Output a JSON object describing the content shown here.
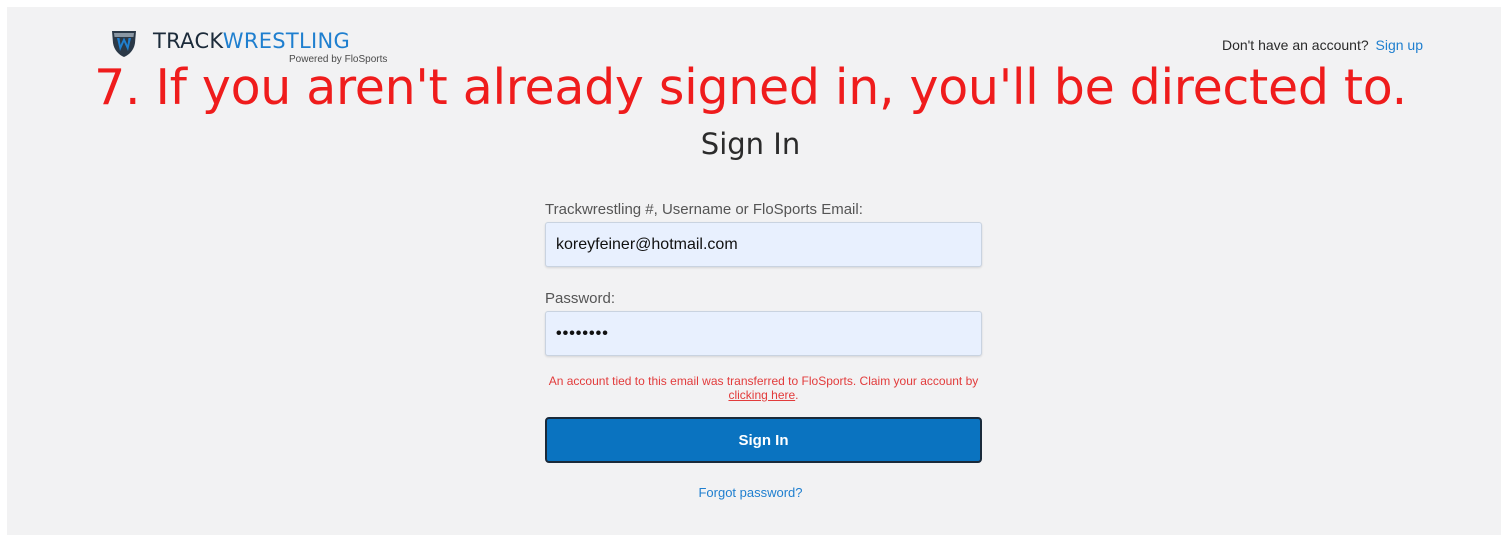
{
  "header": {
    "logo_icon": "trackwrestling-shield-logo",
    "brand_part1": "TRACK",
    "brand_part2": "WRESTLING",
    "powered_by": "Powered by FloSports",
    "signup_prompt": "Don't have an account?",
    "signup_link": "Sign up"
  },
  "caption": "7. If you aren't already signed in, you'll be directed to.",
  "form": {
    "title": "Sign In",
    "username_label": "Trackwrestling #, Username or FloSports Email:",
    "username_value": "koreyfeiner@hotmail.com",
    "password_label": "Password:",
    "password_value": "••••••••",
    "error_text_before": "An account tied to this email was transferred to FloSports. Claim your account by",
    "error_link": "clicking here",
    "error_text_after": ".",
    "submit_label": "Sign In",
    "forgot_link": "Forgot password?"
  },
  "colors": {
    "accent": "#1f7fcf",
    "button": "#0a73c0",
    "error": "#e23b3b",
    "caption": "#ef1c1c",
    "input_bg": "#e8f0fe",
    "page_bg": "#f2f2f3"
  }
}
